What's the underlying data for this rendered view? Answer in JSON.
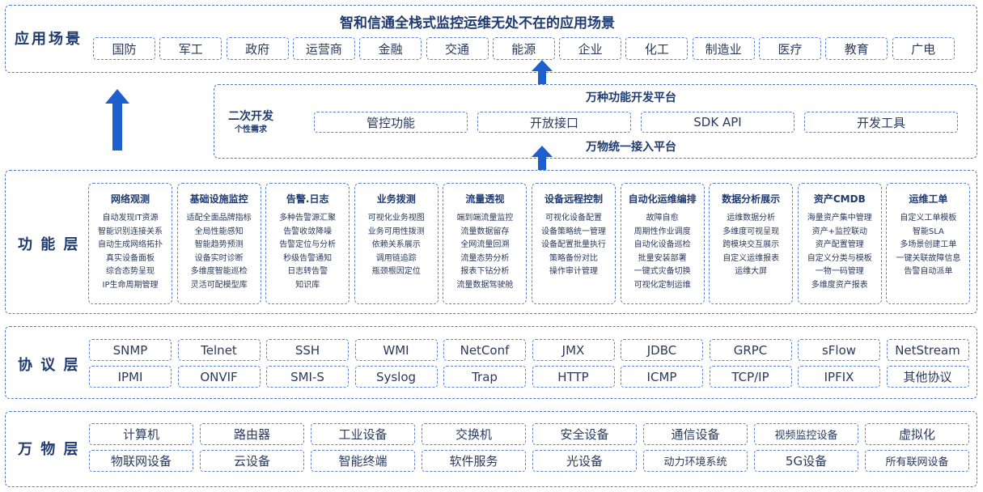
{
  "app": {
    "title": "智和信通全栈式监控运维无处不在的应用场景",
    "label": "应用场景",
    "items": [
      "国防",
      "军工",
      "政府",
      "运营商",
      "金融",
      "交通",
      "能源",
      "企业",
      "化工",
      "制造业",
      "医疗",
      "教育",
      "广电"
    ]
  },
  "dev": {
    "label": "二次开发",
    "sublabel": "个性需求",
    "top_title": "万种功能开发平台",
    "bottom_title": "万物统一接入平台",
    "items": [
      "管控功能",
      "开放接口",
      "SDK API",
      "开发工具"
    ]
  },
  "func": {
    "label": "功 能 层",
    "cards": [
      {
        "title": "网络观测",
        "items": [
          "自动发现IT资源",
          "智能识别连接关系",
          "自动生成网络拓扑",
          "真实设备面板",
          "综合态势呈现",
          "IP生命周期管理"
        ]
      },
      {
        "title": "基础设施监控",
        "items": [
          "适配全面品牌指标",
          "全局性能感知",
          "智能趋势预测",
          "设备实时诊断",
          "多维度智能巡检",
          "灵活可配模型库"
        ]
      },
      {
        "title": "告警.日志",
        "items": [
          "多种告警源汇聚",
          "告警收敛降噪",
          "告警定位与分析",
          "秒级告警通知",
          "日志转告警",
          "知识库"
        ]
      },
      {
        "title": "业务拨测",
        "items": [
          "可视化业务视图",
          "业务可用性拨测",
          "依赖关系展示",
          "调用链追踪",
          "瓶颈根因定位"
        ]
      },
      {
        "title": "流量透视",
        "items": [
          "端到端流量监控",
          "流量数据留存",
          "全网流量回溯",
          "流量态势分析",
          "报表下钻分析",
          "流量数据驾驶舱"
        ]
      },
      {
        "title": "设备远程控制",
        "items": [
          "可视化设备配置",
          "设备策略统一管理",
          "设备配置批量执行",
          "策略备份对比",
          "操作审计管理"
        ]
      },
      {
        "title": "自动化运维编排",
        "items": [
          "故障自愈",
          "周期性作业调度",
          "自动化设备巡检",
          "批量安装部署",
          "一键式灾备切换",
          "可视化定制运维"
        ]
      },
      {
        "title": "数据分析展示",
        "items": [
          "运维数据分析",
          "多维度可视呈现",
          "跨模块交互展示",
          "自定义运维报表",
          "运维大屏"
        ]
      },
      {
        "title": "资产CMDB",
        "items": [
          "海量资产集中管理",
          "资产+监控联动",
          "资产配置管理",
          "自定义分类与模板",
          "一物一码管理",
          "多维度资产报表"
        ]
      },
      {
        "title": "运维工单",
        "items": [
          "自定义工单模板",
          "智能SLA",
          "多场景创建工单",
          "一键关联故障信息",
          "告警自动派单"
        ]
      }
    ]
  },
  "proto": {
    "label": "协 议 层",
    "row1": [
      "SNMP",
      "Telnet",
      "SSH",
      "WMI",
      "NetConf",
      "JMX",
      "JDBC",
      "GRPC",
      "sFlow",
      "NetStream"
    ],
    "row2": [
      "IPMI",
      "ONVIF",
      "SMI-S",
      "Syslog",
      "Trap",
      "HTTP",
      "ICMP",
      "TCP/IP",
      "IPFIX",
      "其他协议"
    ]
  },
  "things": {
    "label": "万 物 层",
    "row1": [
      "计算机",
      "路由器",
      "工业设备",
      "交换机",
      "安全设备",
      "通信设备",
      "视频监控设备",
      "虚拟化"
    ],
    "row2": [
      "物联网设备",
      "云设备",
      "智能终端",
      "软件服务",
      "光设备",
      "动力环境系统",
      "5G设备",
      "所有联网设备"
    ]
  },
  "colors": {
    "accent": "#1e5fcf",
    "border": "#4d78c7",
    "text": "#1f3b70"
  }
}
